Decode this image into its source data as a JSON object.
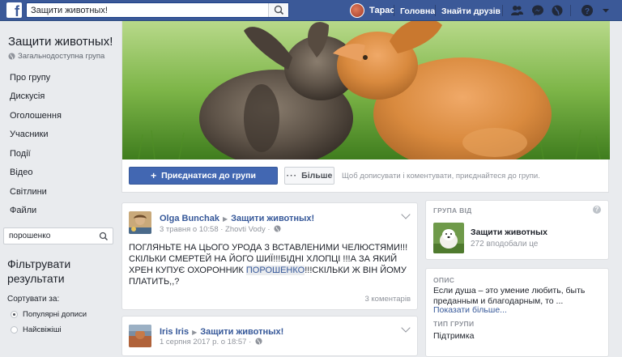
{
  "topbar": {
    "logo": "f",
    "search_value": "Защити животных!",
    "user_name": "Тарас",
    "home_link": "Головна",
    "find_friends_link": "Знайти друзів",
    "bar_color": "#3b5998"
  },
  "group": {
    "title": "Защити животных!",
    "privacy": "Загальнодоступна група"
  },
  "sidebar": {
    "items": [
      {
        "label": "Про групу"
      },
      {
        "label": "Дискусія"
      },
      {
        "label": "Оголошення"
      },
      {
        "label": "Учасники"
      },
      {
        "label": "Події"
      },
      {
        "label": "Відео"
      },
      {
        "label": "Світлини"
      },
      {
        "label": "Файли"
      }
    ],
    "search_value": "порошенко",
    "filter_title": "Фільтрувати результати",
    "sort_label": "Сортувати за:",
    "sort_options": [
      {
        "label": "Популярні дописи",
        "selected": true
      },
      {
        "label": "Найсвіжіші",
        "selected": false
      }
    ]
  },
  "cover": {
    "join_label": "Приєднатися до групи",
    "more_label": "Більше",
    "hint": "Щоб дописувати і коментувати, приєднайтеся до групи."
  },
  "posts": [
    {
      "author": "Olga Bunchak",
      "group": "Защити животных!",
      "meta": "3 травня о 10:58 · Zhovti Vody ·",
      "text_before": "ПОГЛЯНЬТЕ НА ЦЬОГО УРОДА З ВСТАВЛЕНИМИ ЧЕЛЮСТЯМИ!!! СКІЛЬКИ СМЕРТЕЙ НА ЙОГО ШИЇ!!!БІДНІ ХЛОПЦІ !!!А ЗА ЯКИЙ ХРЕН КУПУЄ ОХОРОННИК ",
      "text_highlight": "ПОРОШЕНКО",
      "text_after": "!!!СКІЛЬКИ Ж ВІН ЙОМУ ПЛАТИТЬ,,?",
      "comments": "3 коментарів"
    },
    {
      "author": "Iris Iris",
      "group": "Защити животных!",
      "meta": "1 серпня 2017 р. о 18:57 ·"
    }
  ],
  "right": {
    "group_by_title": "ГРУПА ВІД",
    "page_name": "Защити животных",
    "page_likes": "272 вподобали це",
    "desc_title": "ОПИС",
    "desc_text": "Если душа – это умение любить, быть преданным и благодарным, то ...",
    "show_more": "Показати більше",
    "type_title": "ТИП ГРУПИ",
    "type_value": "Підтримка"
  }
}
